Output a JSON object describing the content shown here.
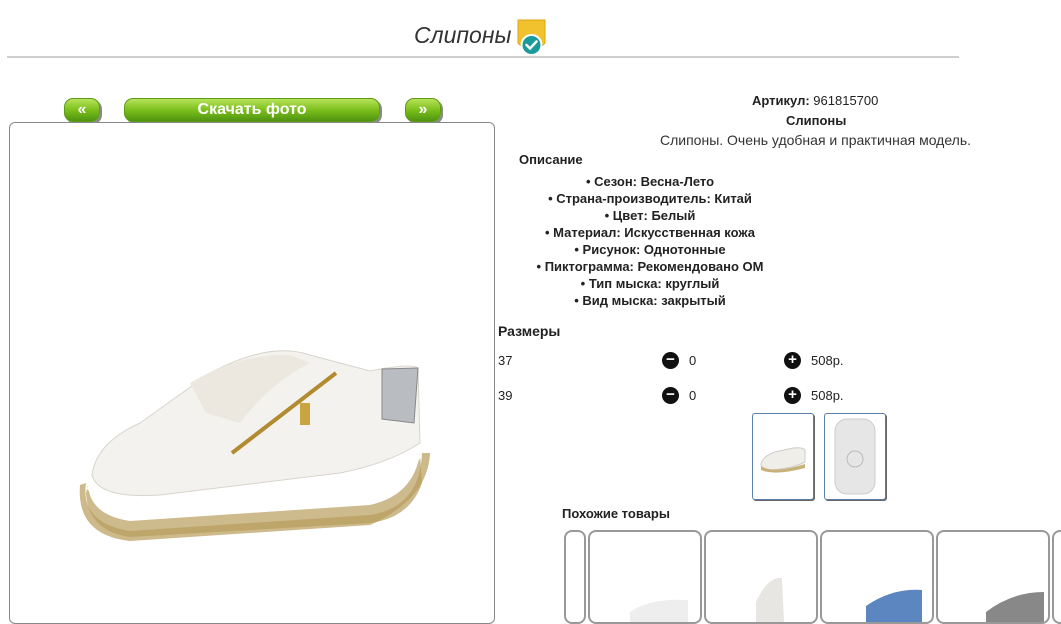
{
  "header": {
    "title": "Слипоны",
    "badge_icon": "verified-check-icon"
  },
  "nav": {
    "prev_label": "«",
    "download_label": "Скачать фото",
    "next_label": "»"
  },
  "product": {
    "article_label": "Артикул:",
    "article_value": "961815700",
    "name": "Слипоны",
    "description": "Слипоны. Очень удобная и практичная модель.",
    "description_heading": "Описание",
    "properties": [
      "• Сезон: Весна-Лето",
      "• Страна-производитель: Китай",
      "• Цвет: Белый",
      "• Материал: Искусственная кожа",
      "• Рисунок: Однотонные",
      "• Пиктограмма: Рекомендовано ОМ",
      "• Тип мыска: круглый",
      "• Вид мыска: закрытый"
    ]
  },
  "sizes": {
    "heading": "Размеры",
    "rows": [
      {
        "size": "37",
        "qty": "0",
        "price": "508р."
      },
      {
        "size": "39",
        "qty": "0",
        "price": "508р."
      }
    ],
    "minus_icon": "minus-circle-icon",
    "plus_icon": "plus-circle-icon"
  },
  "similar": {
    "heading": "Похожие товары"
  },
  "colors": {
    "accent_green": "#7cbf1c",
    "badge_yellow": "#f2c12e",
    "badge_teal": "#1a9a9a"
  }
}
